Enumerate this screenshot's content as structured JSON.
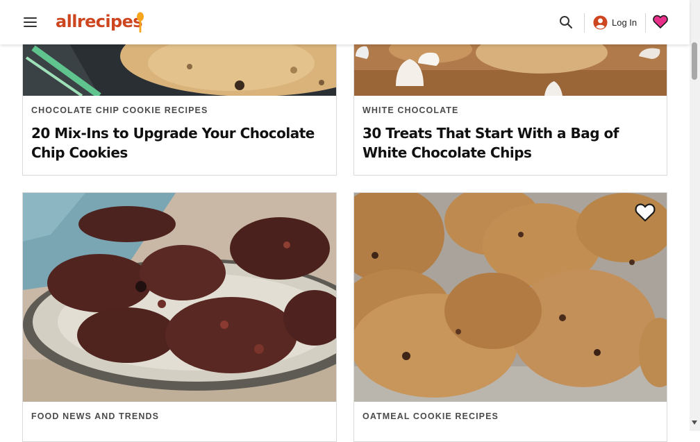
{
  "header": {
    "logo_text": "allrecipes",
    "login_label": "Log In"
  },
  "cards": [
    {
      "tag": "CHOCOLATE CHIP COOKIE RECIPES",
      "title": "20 Mix-Ins to Upgrade Your Chocolate Chip Cookies"
    },
    {
      "tag": "WHITE CHOCOLATE",
      "title": "30 Treats That Start With a Bag of White Chocolate Chips"
    },
    {
      "tag": "FOOD NEWS AND TRENDS",
      "title": ""
    },
    {
      "tag": "OATMEAL COOKIE RECIPES",
      "title": ""
    }
  ],
  "colors": {
    "brand": "#ce4620",
    "spoon": "#f7a51c",
    "favorites_heart": "#e8308a"
  },
  "icons": {
    "menu": "hamburger-menu-icon",
    "search": "search-icon",
    "user": "user-circle-icon",
    "favorites": "heart-icon",
    "save": "heart-outline-icon"
  }
}
